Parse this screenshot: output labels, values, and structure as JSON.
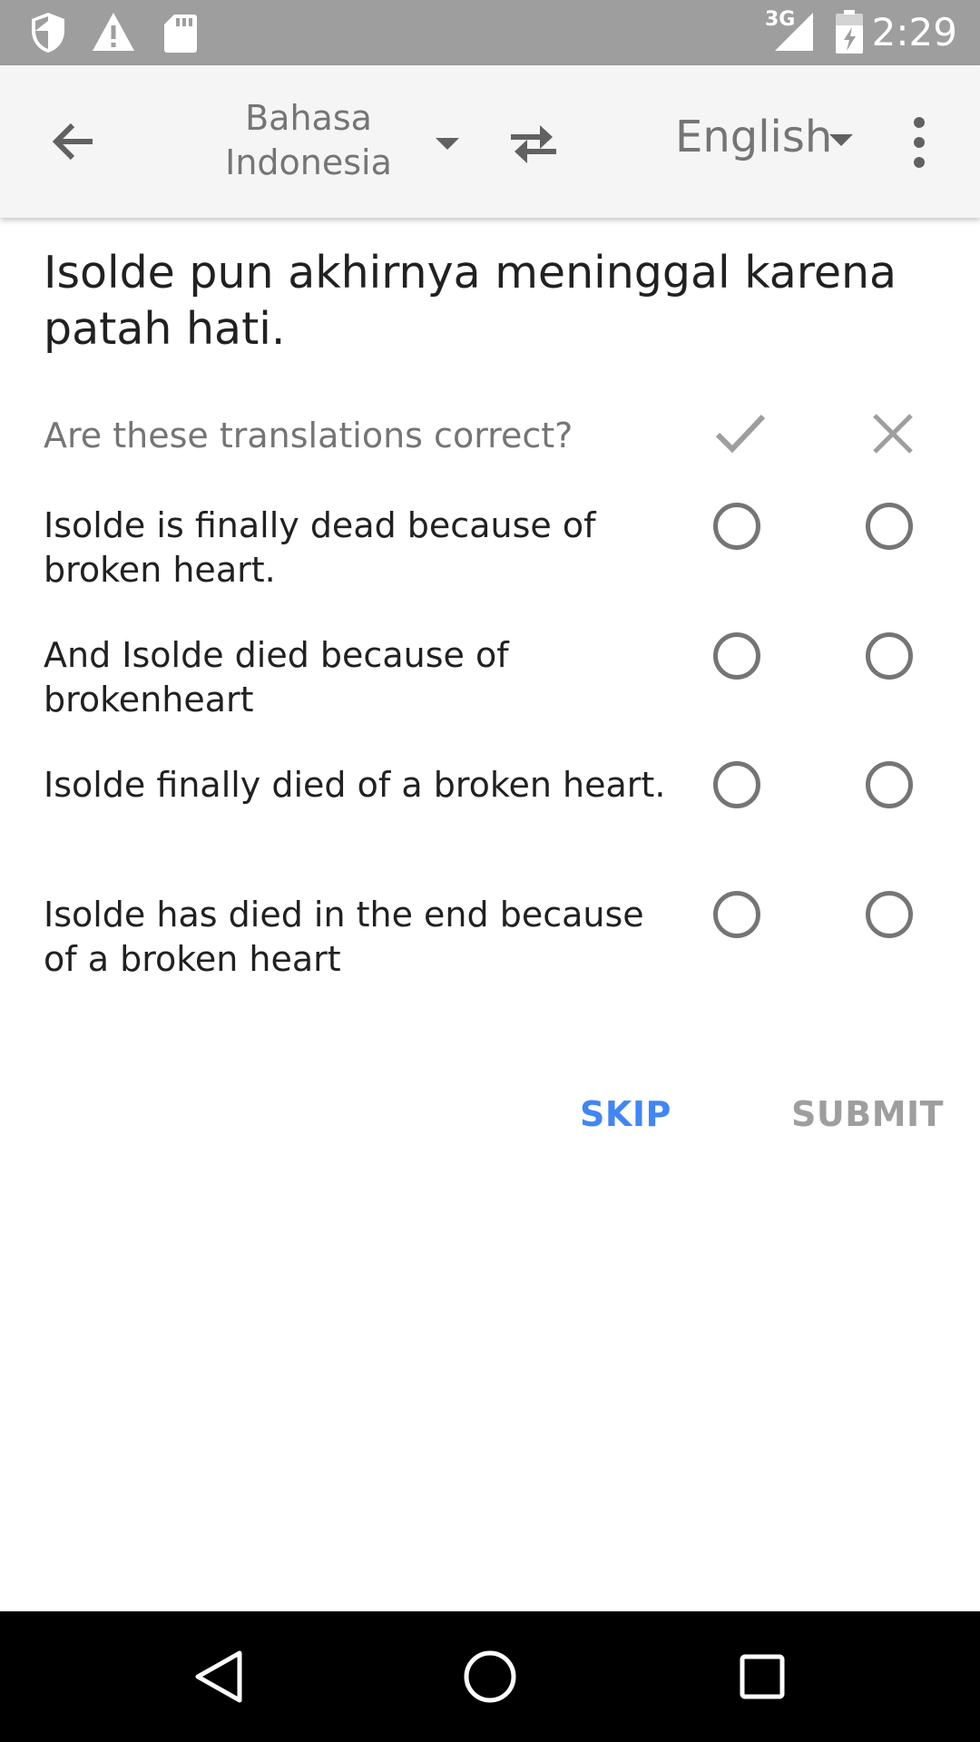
{
  "status_bar": {
    "time": "2:29",
    "network_label": "3G",
    "icons": [
      "shield-icon",
      "warning-icon",
      "sd-card-icon",
      "signal-icon",
      "battery-icon"
    ],
    "background": "#9e9e9e"
  },
  "toolbar": {
    "back_icon": "arrow-back-icon",
    "source_language": "Bahasa Indonesia",
    "target_language": "English",
    "swap_icon": "swap-icon",
    "menu_icon": "more-vert-icon"
  },
  "main": {
    "source_text": "Isolde pun akhirnya meninggal karena patah hati.",
    "question": "Are these translations correct?",
    "correct_icon": "check-icon",
    "incorrect_icon": "close-icon",
    "translations": [
      "Isolde is finally dead because of broken heart.",
      "And Isolde died because of brokenheart",
      "Isolde finally died of a broken heart.",
      "Isolde has died in the end because of a broken heart"
    ]
  },
  "actions": {
    "skip_label": "SKIP",
    "submit_label": "SUBMIT"
  },
  "colors": {
    "accent": "#4285f4",
    "disabled": "#9e9e9e",
    "secondary_text": "#757575"
  },
  "nav_bar": {
    "icons": [
      "back-triangle-icon",
      "home-circle-icon",
      "recents-square-icon"
    ]
  }
}
